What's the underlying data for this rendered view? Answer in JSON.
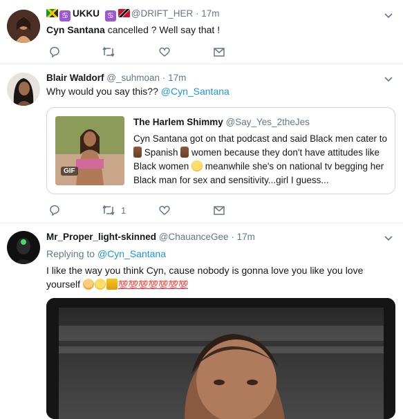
{
  "tweets": [
    {
      "display_name": "UKKU",
      "handle": "@DRIFT_HER",
      "time": "17m",
      "body_mention": "Cyn Santana",
      "body_text": " cancelled ? Well say that !",
      "zodiac_sign": "♋",
      "reply_count": "",
      "retweet_count": "",
      "like_count": ""
    },
    {
      "display_name": "Blair Waldorf",
      "handle": "@_suhmoan",
      "time": "17m",
      "body_text": "Why would you say this?? ",
      "body_link": "@Cyn_Santana",
      "reply_count": "",
      "retweet_count": "1",
      "like_count": ""
    },
    {
      "display_name": "Mr_Proper_light-skinned",
      "handle": "@ChauanceGee",
      "time": "17m",
      "replying_label": "Replying to ",
      "replying_to": "@Cyn_Santana",
      "body_line1": "I like the way you think Cyn, cause nobody is gonna love you like you love",
      "body_line2": "yourself ",
      "hundreds": "💯💯💯💯💯💯💯"
    }
  ],
  "quote": {
    "display_name": "The Harlem Shimmy",
    "handle": "@Say_Yes_2theJes",
    "text_part1": "Cyn Santana got on that podcast and said Black men cater to ",
    "text_part2": " Spanish ",
    "text_part3": " women because they don't have attitudes like Black women ",
    "text_part4": " meanwhile she's on national tv begging her Black man for sex and sensitivity...girl I guess...",
    "gif_label": "GIF"
  },
  "separator": "·",
  "icons": [
    "reply-icon",
    "retweet-icon",
    "like-icon",
    "dm-icon",
    "caret-down-icon"
  ],
  "colors": {
    "link": "#1b95e0",
    "muted": "#657786",
    "border": "#e6ecf0"
  }
}
